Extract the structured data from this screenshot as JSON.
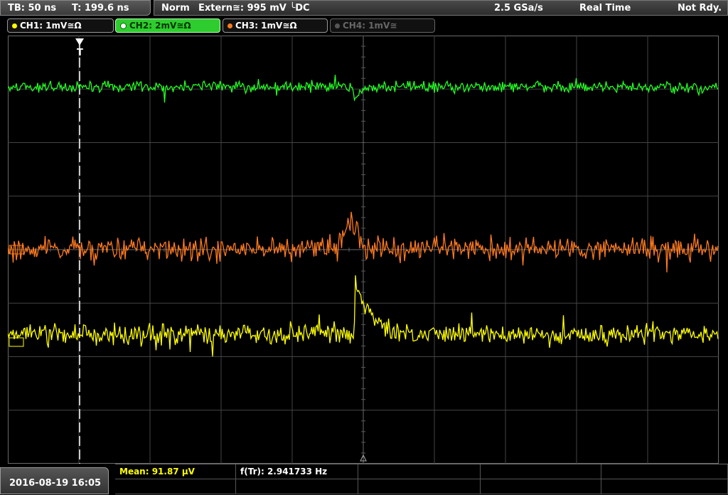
{
  "status": {
    "timebase": "TB: 50 ns",
    "trigger_pos": "T: 199.6 ns",
    "mode": "Norm",
    "trigger": "Extern≅: 995 mV ╰DC",
    "sample_rate": "2.5 GSa/s",
    "acq_mode": "Real Time",
    "run_state": "Not Rdy."
  },
  "channels": [
    {
      "label": "CH1: 1mV≅Ω",
      "color": "#ffff00",
      "state": "on"
    },
    {
      "label": "CH2: 2mV≅Ω",
      "color": "#22ff22",
      "state": "active"
    },
    {
      "label": "CH3: 1mV≅Ω",
      "color": "#ff7a1e",
      "state": "on"
    },
    {
      "label": "CH4: 1mV≅",
      "color": "#777777",
      "state": "off"
    }
  ],
  "trigger_marker": "T",
  "bottom": {
    "datetime": "2016-08-19 16:05",
    "measurements": [
      {
        "label": "Mean: 91.87 µV",
        "color": "#ffff00"
      },
      {
        "label": "f(Tr): 2.941733 Hz",
        "color": "#ffffff"
      }
    ]
  },
  "colors": {
    "ch1": "#ffff00",
    "ch2": "#22ff22",
    "ch3": "#ff7a1e",
    "grid": "#5a5a5a",
    "background": "#000000"
  }
}
